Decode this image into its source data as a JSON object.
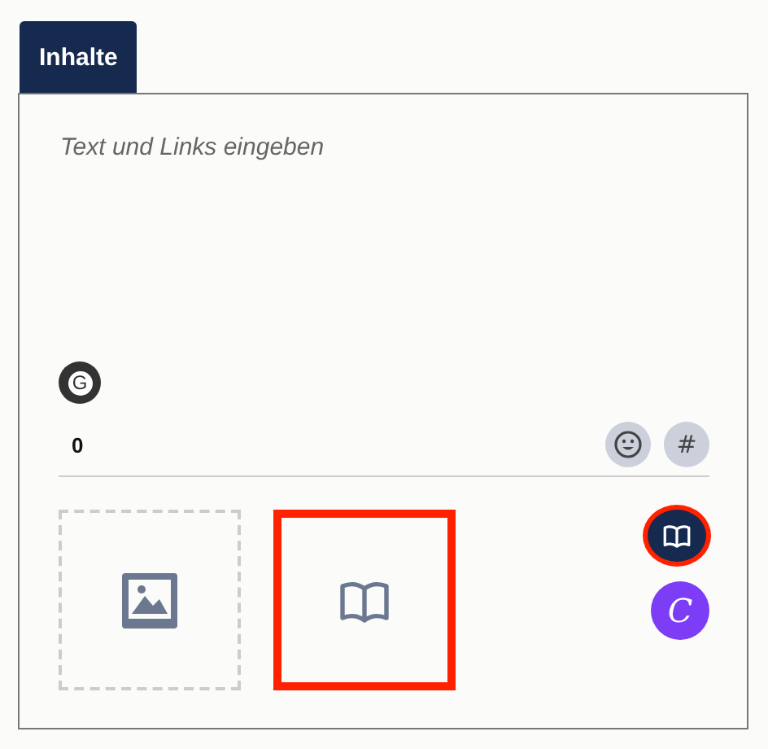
{
  "tabs": [
    {
      "label": "Inhalte",
      "selected": true
    }
  ],
  "editor": {
    "placeholder": "Text und Links eingeben",
    "grammar_badge": "G",
    "counter": "0",
    "tools": [
      {
        "kind": "emoji"
      },
      {
        "kind": "hashtag",
        "label": "#"
      }
    ]
  },
  "media_tiles": [
    {
      "kind": "image",
      "highlighted": false
    },
    {
      "kind": "book",
      "highlighted": true
    }
  ],
  "side_buttons": [
    {
      "kind": "book",
      "highlighted": true
    },
    {
      "kind": "canva",
      "label": "C"
    }
  ]
}
